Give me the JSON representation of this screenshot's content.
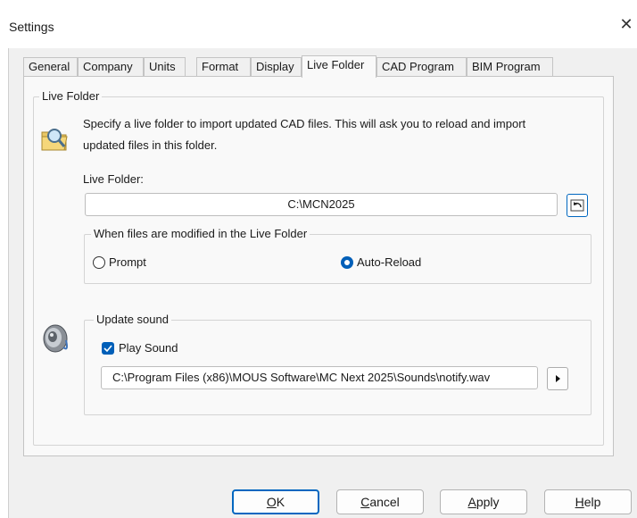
{
  "window": {
    "title": "Settings",
    "close_glyph": "✕"
  },
  "tabs": [
    {
      "label": "General"
    },
    {
      "label": "Company"
    },
    {
      "label": "Units"
    },
    {
      "label": "Format"
    },
    {
      "label": "Display"
    },
    {
      "label": "Live Folder",
      "active": true
    },
    {
      "label": "CAD Program"
    },
    {
      "label": "BIM Program"
    }
  ],
  "live_folder": {
    "group_title": "Live Folder",
    "description_line1": "Specify a live folder to import updated CAD files. This will ask you to reload and import",
    "description_line2": "updated files in this folder.",
    "folder_label": "Live Folder:",
    "folder_value": "C:\\MCN2025",
    "browse_icon": "undo-folder-icon",
    "folder_icon": "folder-magnifier-icon",
    "modified_group_title": "When files are modified in the Live Folder",
    "options": [
      {
        "label": "Prompt",
        "selected": false
      },
      {
        "label": "Auto-Reload",
        "selected": true
      }
    ]
  },
  "sound": {
    "group_title": "Update sound",
    "icon": "speaker-icon",
    "play_sound_label": "Play Sound",
    "play_sound_checked": true,
    "path_value": "C:\\Program Files (x86)\\MOUS Software\\MC Next 2025\\Sounds\\notify.wav",
    "play_icon": "play-icon"
  },
  "buttons": {
    "ok_mn": "O",
    "ok_rest": "K",
    "cancel_mn": "C",
    "cancel_rest": "ancel",
    "apply_mn": "A",
    "apply_rest": "pply",
    "help_mn": "H",
    "help_rest": "elp"
  },
  "colors": {
    "accent": "#005fb8",
    "default_button_border": "#0067c0"
  }
}
